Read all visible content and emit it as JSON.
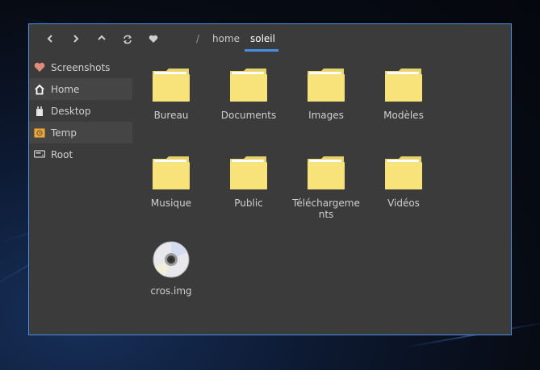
{
  "toolbar": {
    "back_icon": "chevron-left-icon",
    "forward_icon": "chevron-right-icon",
    "up_icon": "chevron-up-icon",
    "refresh_icon": "refresh-icon",
    "favorite_icon": "heart-icon"
  },
  "breadcrumb": {
    "separator": "/",
    "items": [
      {
        "label": "home",
        "active": false
      },
      {
        "label": "soleil",
        "active": true
      }
    ]
  },
  "sidebar": {
    "items": [
      {
        "label": "Screenshots",
        "icon": "heart-icon",
        "highlighted": false
      },
      {
        "label": "Home",
        "icon": "home-icon",
        "highlighted": true
      },
      {
        "label": "Desktop",
        "icon": "desktop-icon",
        "highlighted": false
      },
      {
        "label": "Temp",
        "icon": "temp-folder-icon",
        "highlighted": true
      },
      {
        "label": "Root",
        "icon": "drive-icon",
        "highlighted": false
      }
    ]
  },
  "files": [
    {
      "name": "Bureau",
      "type": "folder"
    },
    {
      "name": "Documents",
      "type": "folder"
    },
    {
      "name": "Images",
      "type": "folder"
    },
    {
      "name": "Modèles",
      "type": "folder"
    },
    {
      "name": "Musique",
      "type": "folder"
    },
    {
      "name": "Public",
      "type": "folder"
    },
    {
      "name": "Téléchargements",
      "type": "folder"
    },
    {
      "name": "Vidéos",
      "type": "folder"
    },
    {
      "name": "cros.img",
      "type": "disc-image"
    }
  ],
  "colors": {
    "accent": "#4a90e2",
    "window_bg": "#3b3b3b",
    "folder": "#f7e37a",
    "heart": "#e08a7a"
  }
}
